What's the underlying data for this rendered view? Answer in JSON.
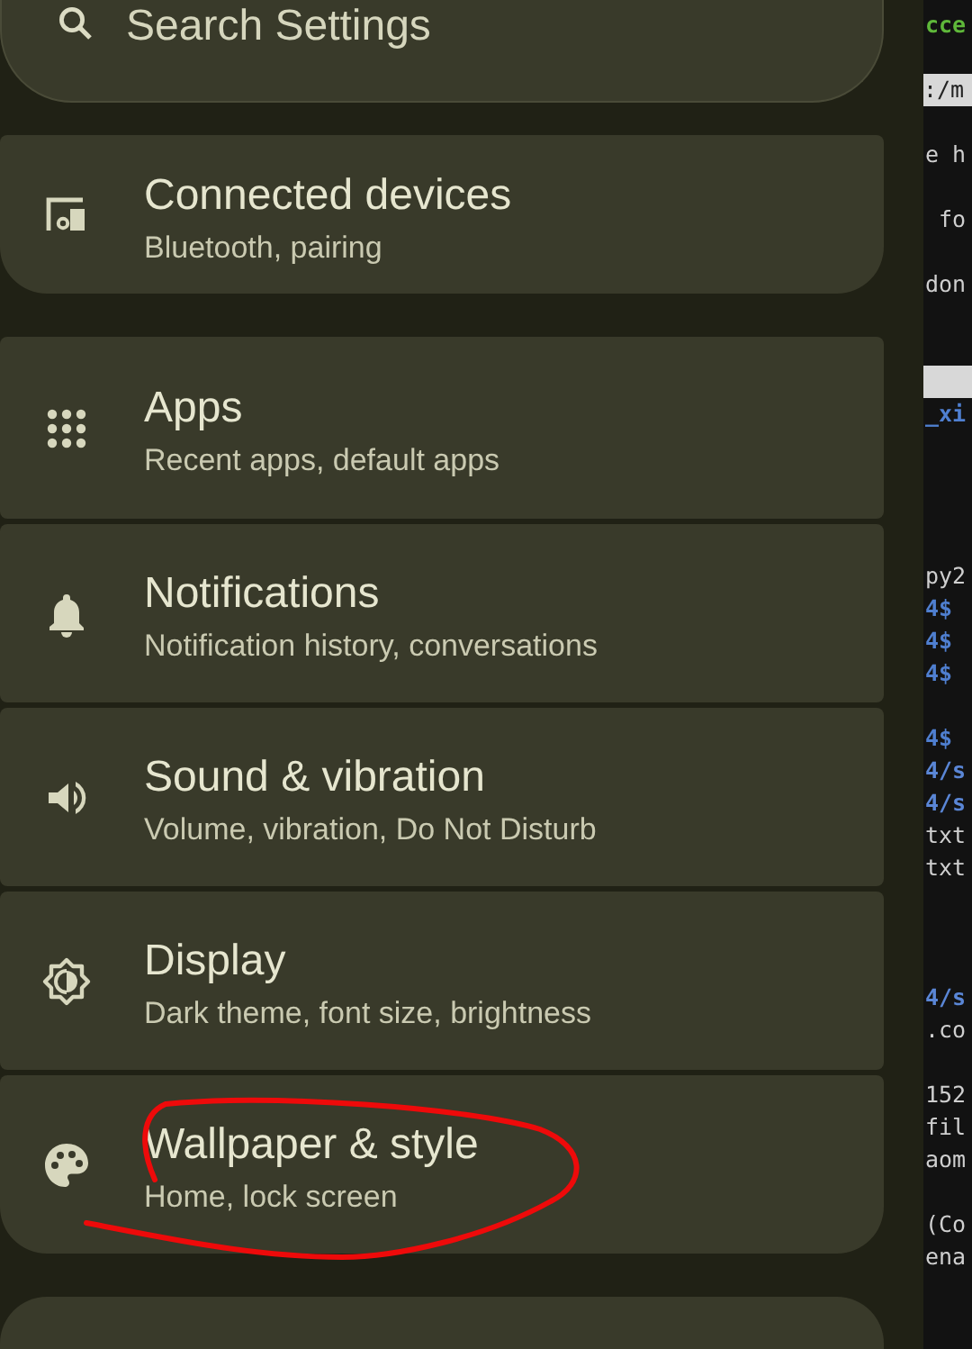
{
  "search": {
    "placeholder": "Search Settings"
  },
  "groups": [
    {
      "items": [
        {
          "kind": "devices",
          "title": "Connected devices",
          "subtitle": "Bluetooth, pairing",
          "circled": false
        }
      ]
    },
    {
      "items": [
        {
          "kind": "apps",
          "title": "Apps",
          "subtitle": "Recent apps, default apps",
          "circled": false
        },
        {
          "kind": "bell",
          "title": "Notifications",
          "subtitle": "Notification history, conversations",
          "circled": false
        },
        {
          "kind": "speaker",
          "title": "Sound & vibration",
          "subtitle": "Volume, vibration, Do Not Disturb",
          "circled": false
        },
        {
          "kind": "display",
          "title": "Display",
          "subtitle": "Dark theme, font size, brightness",
          "circled": false
        },
        {
          "kind": "palette",
          "title": "Wallpaper & style",
          "subtitle": "Home, lock screen",
          "circled": true
        }
      ]
    }
  ],
  "terminal": {
    "lines": [
      {
        "kind": "title",
        "text": "cce"
      },
      {
        "kind": "blank"
      },
      {
        "kind": "selected",
        "text": ":/m"
      },
      {
        "kind": "blank"
      },
      {
        "kind": "output",
        "text": "e h"
      },
      {
        "kind": "blank"
      },
      {
        "kind": "output",
        "text": " fo"
      },
      {
        "kind": "blank"
      },
      {
        "kind": "output",
        "text": "don"
      },
      {
        "kind": "blank"
      },
      {
        "kind": "blank"
      },
      {
        "kind": "bar"
      },
      {
        "kind": "prompt",
        "text": "_xi"
      },
      {
        "kind": "blank"
      },
      {
        "kind": "blank"
      },
      {
        "kind": "blank"
      },
      {
        "kind": "blank"
      },
      {
        "kind": "output",
        "text": "py2"
      },
      {
        "kind": "prompt",
        "text": "4$"
      },
      {
        "kind": "prompt",
        "text": "4$"
      },
      {
        "kind": "prompt",
        "text": "4$"
      },
      {
        "kind": "blank"
      },
      {
        "kind": "prompt",
        "text": "4$"
      },
      {
        "kind": "path",
        "text": "4/s"
      },
      {
        "kind": "path",
        "text": "4/s"
      },
      {
        "kind": "output",
        "text": "txt"
      },
      {
        "kind": "output",
        "text": "txt"
      },
      {
        "kind": "blank"
      },
      {
        "kind": "blank"
      },
      {
        "kind": "blank"
      },
      {
        "kind": "path",
        "text": "4/s"
      },
      {
        "kind": "output",
        "text": ".co"
      },
      {
        "kind": "blank"
      },
      {
        "kind": "output",
        "text": "152"
      },
      {
        "kind": "output",
        "text": "fil"
      },
      {
        "kind": "output",
        "text": "aom"
      },
      {
        "kind": "blank"
      },
      {
        "kind": "output",
        "text": "(Co"
      },
      {
        "kind": "output",
        "text": "ena"
      }
    ]
  }
}
